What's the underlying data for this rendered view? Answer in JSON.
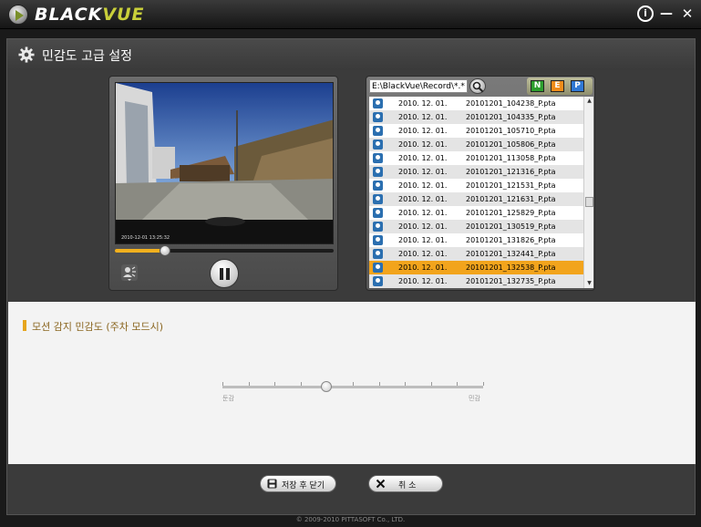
{
  "app": {
    "brand_black": "BLACK",
    "brand_vue": "VUE",
    "window_controls": [
      "info-icon",
      "minimize-icon",
      "close-icon"
    ]
  },
  "header": {
    "title": "민감도 고급 설정",
    "icon": "gear-icon"
  },
  "player": {
    "timestamp": "2010-12-01 13:25:32",
    "progress": 0.23,
    "mic_icon": "microphone-icon",
    "pause_icon": "pause-icon"
  },
  "browser": {
    "path": "E:\\BlackVue\\Record\\*.*",
    "filters": [
      "N",
      "E",
      "P"
    ],
    "files": [
      {
        "date": "2010. 12. 01.",
        "name": "20101201_104238_P.pta"
      },
      {
        "date": "2010. 12. 01.",
        "name": "20101201_104335_P.pta"
      },
      {
        "date": "2010. 12. 01.",
        "name": "20101201_105710_P.pta"
      },
      {
        "date": "2010. 12. 01.",
        "name": "20101201_105806_P.pta"
      },
      {
        "date": "2010. 12. 01.",
        "name": "20101201_113058_P.pta"
      },
      {
        "date": "2010. 12. 01.",
        "name": "20101201_121316_P.pta"
      },
      {
        "date": "2010. 12. 01.",
        "name": "20101201_121531_P.pta"
      },
      {
        "date": "2010. 12. 01.",
        "name": "20101201_121631_P.pta"
      },
      {
        "date": "2010. 12. 01.",
        "name": "20101201_125829_P.pta"
      },
      {
        "date": "2010. 12. 01.",
        "name": "20101201_130519_P.pta"
      },
      {
        "date": "2010. 12. 01.",
        "name": "20101201_131826_P.pta"
      },
      {
        "date": "2010. 12. 01.",
        "name": "20101201_132441_P.pta"
      },
      {
        "date": "2010. 12. 01.",
        "name": "20101201_132538_P.pta"
      },
      {
        "date": "2010. 12. 01.",
        "name": "20101201_132735_P.pta"
      }
    ],
    "selected_index": 12
  },
  "sensitivity": {
    "title": "모션 감지 민감도 (주차 모드시)",
    "low_label": "둔감",
    "high_label": "민감",
    "value": 0.4,
    "steps": 11
  },
  "buttons": {
    "save_close": "저장 후 닫기",
    "cancel": "취 소"
  },
  "footer": {
    "copyright": "© 2009-2010 PITTASOFT Co., LTD."
  },
  "colors": {
    "accent": "#f2a41c",
    "filter_n": "#2d9e2d",
    "filter_e": "#f08c1a",
    "filter_p": "#2f78d4"
  }
}
